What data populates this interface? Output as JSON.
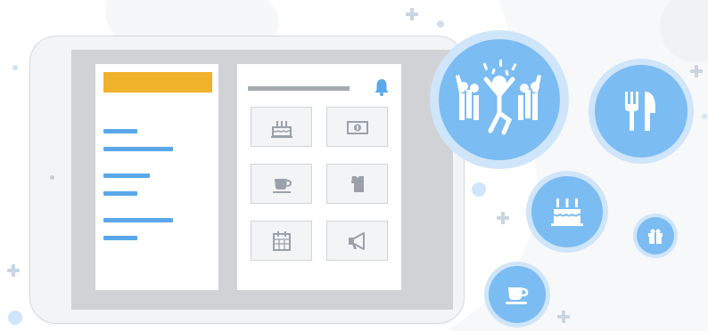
{
  "illustration": {
    "tablet_tiles": [
      {
        "icon": "birthday-cake-icon"
      },
      {
        "icon": "money-icon"
      },
      {
        "icon": "coffee-cup-icon"
      },
      {
        "icon": "shirt-icon"
      },
      {
        "icon": "calendar-icon"
      },
      {
        "icon": "megaphone-icon"
      }
    ],
    "bubbles": [
      {
        "icon": "celebration-crowd-icon"
      },
      {
        "icon": "fork-knife-icon"
      },
      {
        "icon": "birthday-cake-icon"
      },
      {
        "icon": "gift-icon"
      },
      {
        "icon": "coffee-cup-icon"
      }
    ],
    "colors": {
      "accent_blue": "#5aa8ea",
      "bubble_blue": "#7bbcf2",
      "bubble_ring": "#cfe5fa",
      "header_yellow": "#f0b12b",
      "tablet_frame": "#f3f4f6",
      "tile_icon_gray": "#9aa1aa"
    }
  }
}
